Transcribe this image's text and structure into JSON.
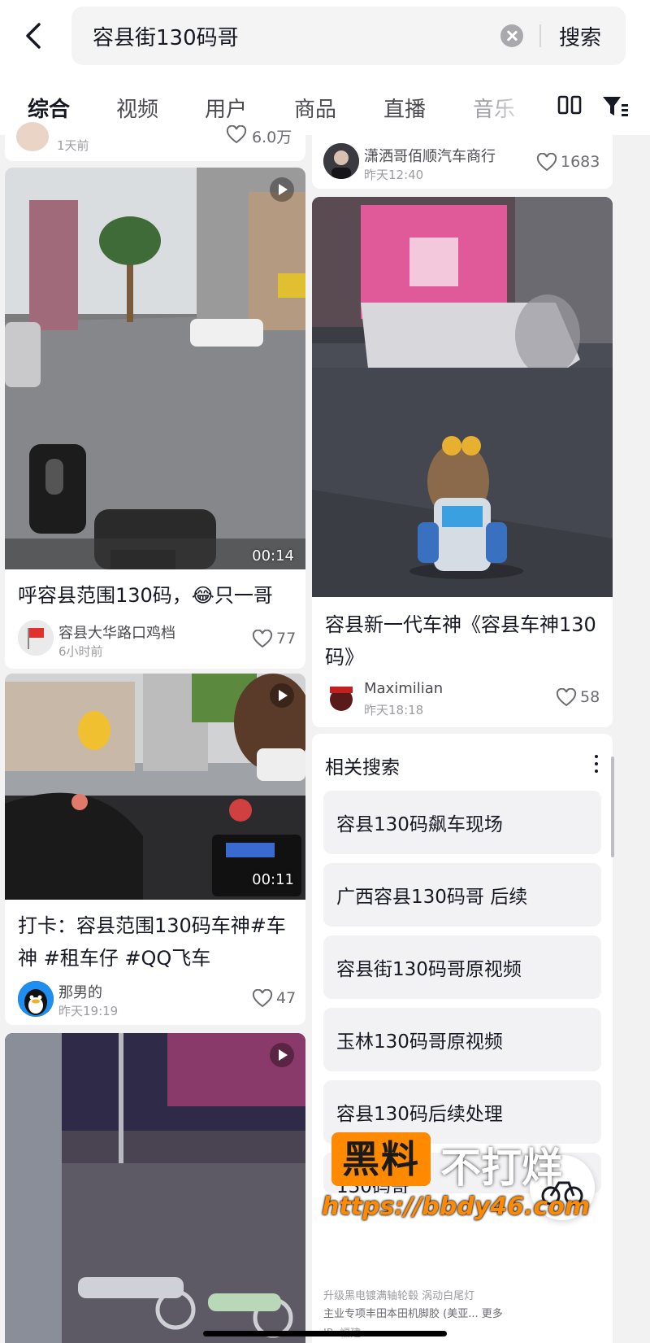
{
  "search": {
    "query": "容县街130码哥",
    "button_label": "搜索"
  },
  "tabs": [
    "综合",
    "视频",
    "用户",
    "商品",
    "直播",
    "音乐"
  ],
  "left_column": {
    "top_partial": {
      "time": "1天前",
      "likes": "6.0万"
    },
    "cards": [
      {
        "duration": "00:14",
        "title": "呼容县范围130码，😂只一哥",
        "author": "容县大华路口鸡档",
        "time": "6小时前",
        "likes": "77"
      },
      {
        "duration": "00:11",
        "title": "打卡：容县范围130码车神#车神 #租车仔 #QQ飞车",
        "author": "那男的",
        "time": "昨天19:19",
        "likes": "47"
      }
    ]
  },
  "right_column": {
    "top_card": {
      "author": "潇洒哥佰顺汽车商行",
      "time": "昨天12:40",
      "likes": "1683"
    },
    "video_card": {
      "title": "容县新一代车神《容县车神130码》",
      "author": "Maximilian",
      "time": "昨天18:18",
      "likes": "58"
    },
    "related": {
      "title": "相关搜索",
      "items": [
        "容县130码飙车现场",
        "广西容县130码哥 后续",
        "容县街130码哥原视频",
        "玉林130码哥原视频",
        "容县130码后续处理",
        "130码哥"
      ]
    },
    "bottom_lines": [
      "升级黑电镀满轴轮毂 涡动白尾灯",
      "主业专项丰田本田机脚胶 (美亚... 更多",
      "IP: 福建"
    ]
  },
  "watermark": {
    "box_text": "黑料",
    "text": "不打烊",
    "url": "https://bbdy46.com"
  }
}
